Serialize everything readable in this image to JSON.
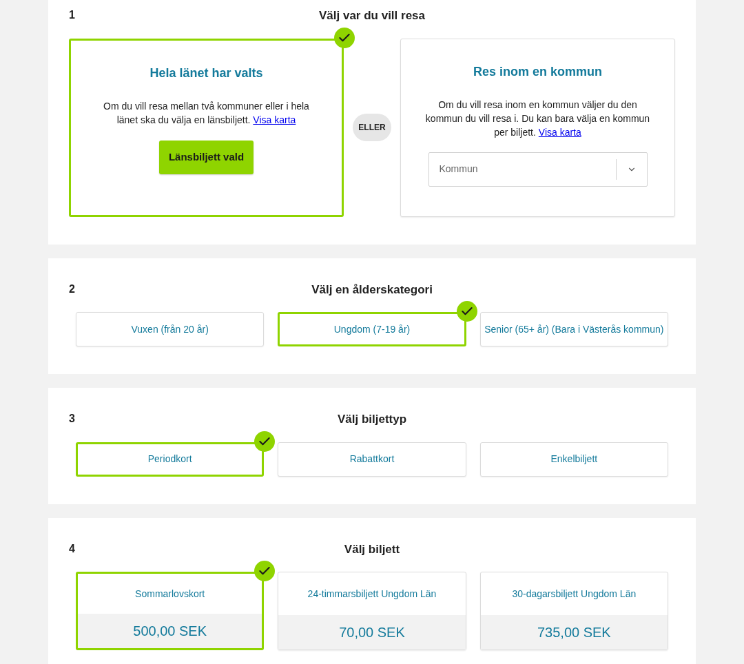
{
  "steps": [
    {
      "number": "1",
      "title": "Välj var du vill resa",
      "kind": "region",
      "divider": "ELLER",
      "options": [
        {
          "kind": "button",
          "title": "Hela länet har valts",
          "text": "Om du vill resa mellan två kommuner eller i hela länet ska du välja en länsbiljett.",
          "link": "Visa karta",
          "button": "Länsbiljett vald",
          "selected": true
        },
        {
          "kind": "select",
          "title": "Res inom en kommun",
          "text": "Om du vill resa inom en kommun väljer du den kommun du vill resa i. Du kan bara välja en kommun per biljett.",
          "link": "Visa karta",
          "placeholder": "Kommun",
          "selected": false
        }
      ]
    },
    {
      "number": "2",
      "title": "Välj en ålderskategori",
      "kind": "choice",
      "options": [
        {
          "label": "Vuxen (från 20 år)",
          "selected": false
        },
        {
          "label": "Ungdom (7-19 år)",
          "selected": true
        },
        {
          "label": "Senior (65+ år) (Bara i Västerås kommun)",
          "selected": false
        }
      ]
    },
    {
      "number": "3",
      "title": "Välj biljettyp",
      "kind": "choice",
      "options": [
        {
          "label": "Periodkort",
          "selected": true
        },
        {
          "label": "Rabattkort",
          "selected": false
        },
        {
          "label": "Enkelbiljett",
          "selected": false
        }
      ]
    },
    {
      "number": "4",
      "title": "Välj biljett",
      "kind": "ticket",
      "options": [
        {
          "label": "Sommarlovskort",
          "price": "500,00 SEK",
          "selected": true
        },
        {
          "label": "24-timmarsbiljett Ungdom Län",
          "price": "70,00 SEK",
          "selected": false
        },
        {
          "label": "30-dagarsbiljett Ungdom Län",
          "price": "735,00 SEK",
          "selected": false
        }
      ]
    }
  ]
}
